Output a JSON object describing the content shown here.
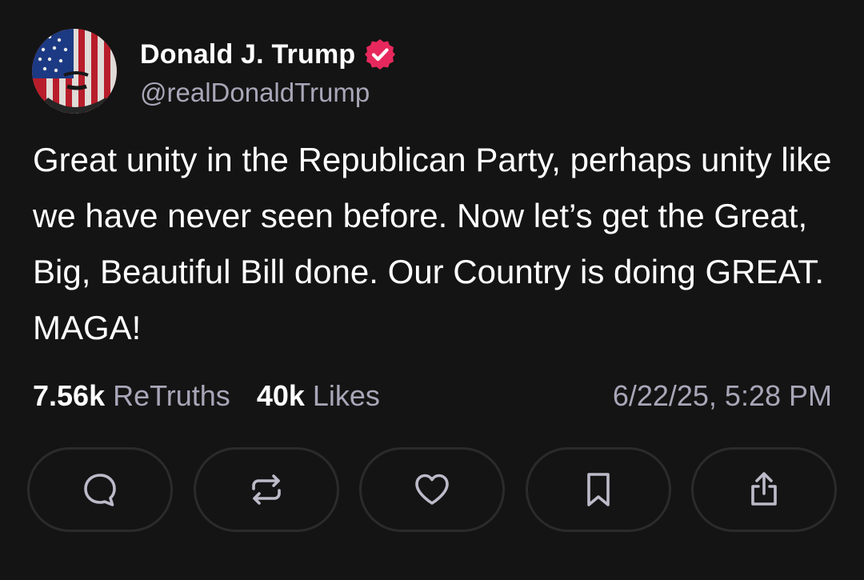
{
  "author": {
    "display_name": "Donald J. Trump",
    "handle": "@realDonaldTrump",
    "verified": true,
    "avatar_icon": "flag-painted-face-avatar",
    "verified_color": "#e7285c"
  },
  "post": {
    "text": "Great unity in the Republican Party, perhaps unity like we have never seen before. Now let’s get the Great, Big, Beautiful Bill done. Our Country is doing GREAT. MAGA!"
  },
  "stats": {
    "retruths_count": "7.56k",
    "retruths_label": "ReTruths",
    "likes_count": "40k",
    "likes_label": "Likes",
    "timestamp": "6/22/25, 5:28 PM"
  },
  "actions": [
    {
      "name": "reply",
      "icon": "chat-bubble-icon"
    },
    {
      "name": "retruth",
      "icon": "repost-arrows-icon"
    },
    {
      "name": "like",
      "icon": "heart-icon"
    },
    {
      "name": "bookmark",
      "icon": "bookmark-icon"
    },
    {
      "name": "share",
      "icon": "share-upload-icon"
    }
  ],
  "colors": {
    "background": "#141414",
    "primary_text": "#ffffff",
    "secondary_text": "#a9a6b8",
    "button_border": "#2b2b2b",
    "icon": "#bdbac9"
  }
}
